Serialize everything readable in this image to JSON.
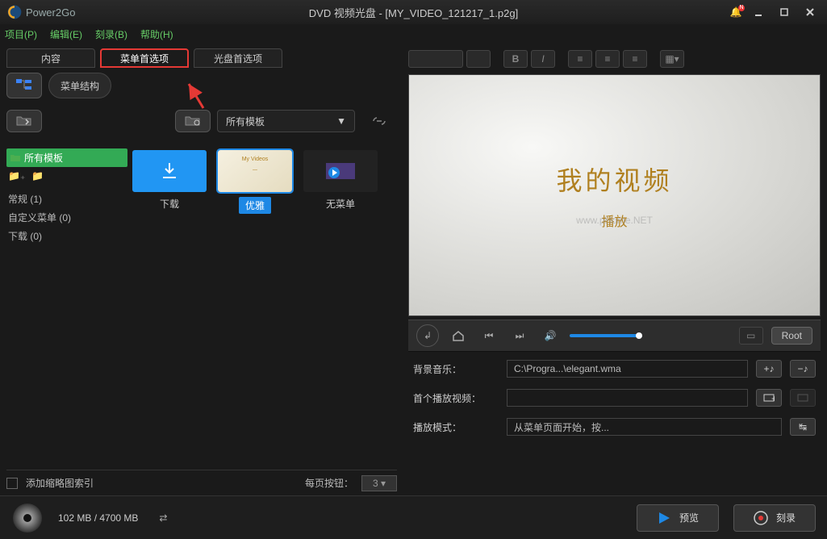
{
  "app": {
    "name": "Power2Go"
  },
  "title": "DVD 视频光盘 - [MY_VIDEO_121217_1.p2g]",
  "notification": {
    "badge": "N"
  },
  "menu": {
    "project": "项目(P)",
    "edit": "编辑(E)",
    "burn": "刻录(B)",
    "help": "帮助(H)"
  },
  "tabs": {
    "content": "内容",
    "menu_pref": "菜单首选项",
    "disc_pref": "光盘首选项"
  },
  "menu_structure": "菜单结构",
  "template_dd": "所有模板",
  "categories": {
    "all": "所有模板"
  },
  "tree": {
    "general": "常规 (1)",
    "custom": "自定义菜单 (0)",
    "download": "下载 (0)"
  },
  "cards": {
    "download": "下载",
    "elegant": "优雅",
    "nomenu": "无菜单"
  },
  "bottom": {
    "thumb_index": "添加缩略图索引",
    "per_page": "每页按钮：",
    "per_page_val": "3"
  },
  "preview": {
    "title": "我的视频",
    "play": "播放"
  },
  "player": {
    "root": "Root"
  },
  "form": {
    "bgm_label": "背景音乐：",
    "bgm_val": "C:\\Progra...\\elegant.wma",
    "first_label": "首个播放视频：",
    "first_val": "",
    "mode_label": "播放模式：",
    "mode_val": "从菜单页面开始，按..."
  },
  "footer": {
    "capacity": "102 MB / 4700 MB",
    "preview": "预览",
    "burn": "刻录"
  }
}
